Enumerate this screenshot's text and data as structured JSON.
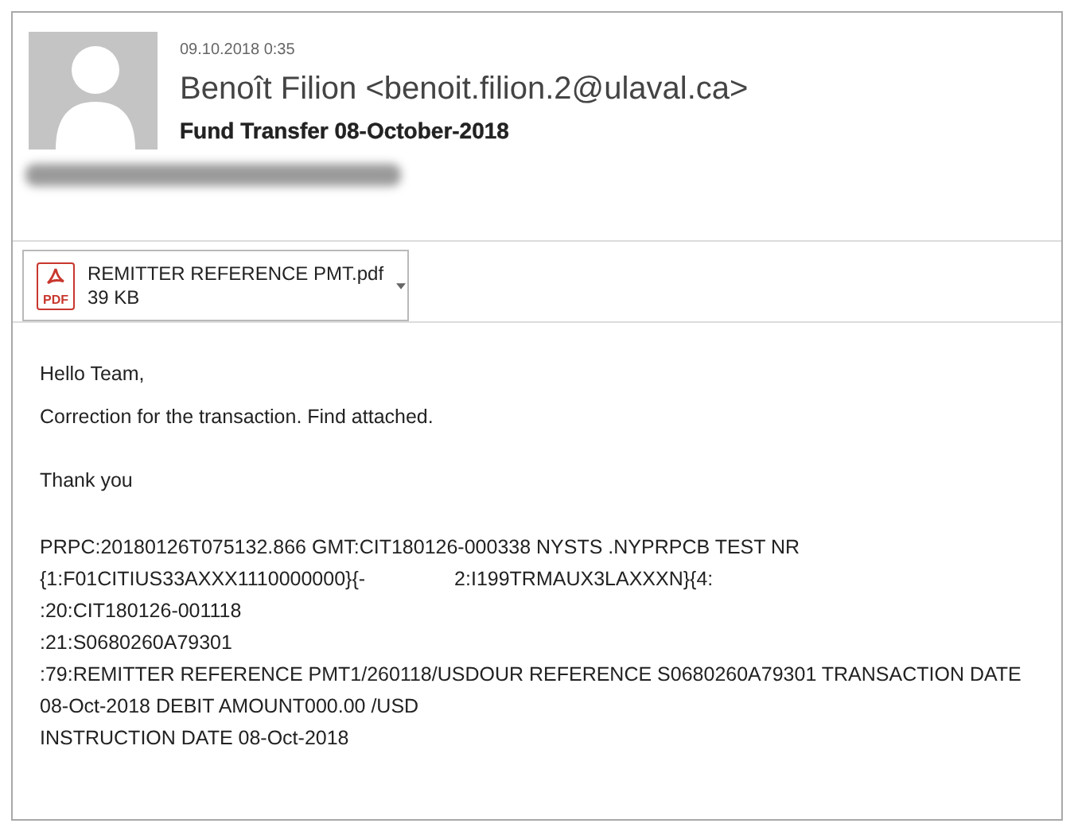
{
  "message": {
    "date": "09.10.2018 0:35",
    "sender": "Benoît Filion <benoit.filion.2@ulaval.ca>",
    "subject": "Fund Transfer 08-October-2018"
  },
  "attachment": {
    "name": "REMITTER REFERENCE PMT.pdf",
    "size": "39 KB",
    "icon_label": "PDF"
  },
  "body": {
    "paragraphs": [
      "Hello Team,",
      "Correction for the transaction. Find attached.",
      "Thank you"
    ],
    "code_lines": [
      [
        "PRPC:20180126T075132.866 GMT:CIT180126-000338 NYSTS .NYPRPCB TEST NR"
      ],
      [
        "{1:F01CITIUS33AXXX1110000000}{-",
        "2:I199TRMAUX3LAXXXN}{4:"
      ],
      [
        ":20:CIT180126-001118"
      ],
      [
        ":21:S0680260A79301"
      ],
      [
        ":79:REMITTER REFERENCE PMT1/260118/USDOUR REFERENCE S0680260A79301 TRANSACTION DATE"
      ],
      [
        "08-Oct-2018 DEBIT AMOUNT000.00 /USD"
      ],
      [
        "INSTRUCTION DATE 08-Oct-2018"
      ]
    ]
  }
}
